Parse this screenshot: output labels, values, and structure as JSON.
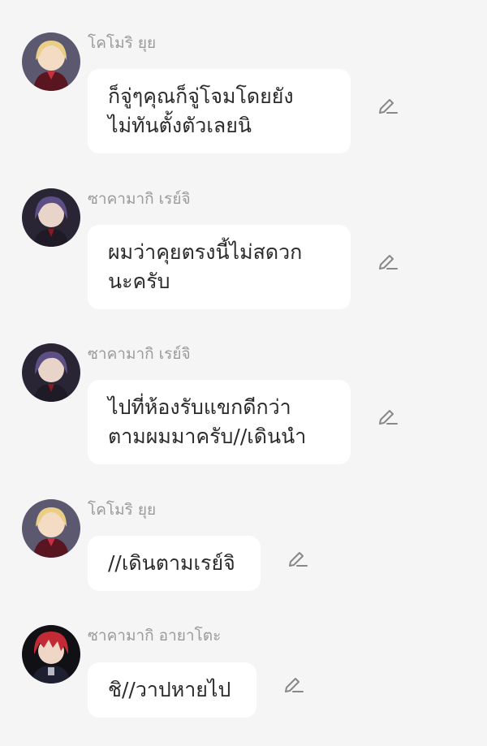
{
  "messages": [
    {
      "sender": "โคโมริ ยุย",
      "avatar": "yui-avatar",
      "lines": [
        "ก็จู่ๆคุณก็จู่โจมโดยยัง",
        "ไม่ทันตั้งตัวเลยนิ"
      ],
      "edit_icon": "pencil-icon"
    },
    {
      "sender": "ซาคามากิ เรย์จิ",
      "avatar": "reiji-avatar",
      "lines": [
        "ผมว่าคุยตรงนี้ไม่สดวก",
        "นะครับ"
      ],
      "edit_icon": "pencil-icon"
    },
    {
      "sender": "ซาคามากิ เรย์จิ",
      "avatar": "reiji-avatar",
      "lines": [
        "ไปที่ห้องรับแขกดีกว่า",
        "ตามผมมาครับ//เดินนำ"
      ],
      "edit_icon": "pencil-icon"
    },
    {
      "sender": "โคโมริ ยุย",
      "avatar": "yui-avatar",
      "lines": [
        "//เดินตามเรย์จิ"
      ],
      "edit_icon": "pencil-icon"
    },
    {
      "sender": "ซาคามากิ อายาโตะ",
      "avatar": "ayato-avatar",
      "lines": [
        "ชิ//วาปหายไป"
      ],
      "edit_icon": "pencil-icon"
    }
  ],
  "colors": {
    "background": "#f5f5f5",
    "bubble": "#ffffff",
    "sender_name": "#9a9a9a",
    "message_text": "#2b2b2b",
    "icon": "#888888"
  }
}
